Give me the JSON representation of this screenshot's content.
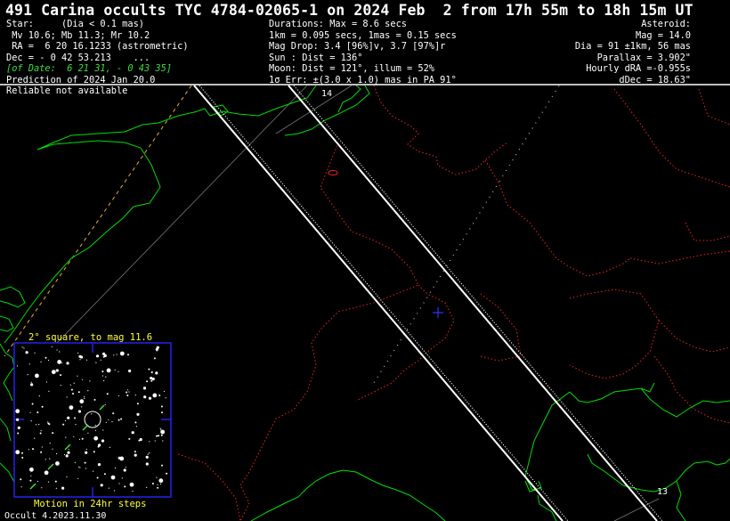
{
  "title": "491 Carina occults TYC 4784-02065-1 on 2024 Feb  2 from 17h 55m to 18h 15m UT",
  "star": {
    "heading": "Star:     (Dia < 0.1 mas)",
    "mags": " Mv 10.6; Mb 11.3; Mr 10.2",
    "ra": " RA =  6 20 16.1233 (astrometric)",
    "dec": "Dec = - 0 42 53.213    ...",
    "of_date": "[of Date:  6 21 31, - 0 43 35]",
    "prediction": "Prediction of 2024 Jan 20.0",
    "reliability": "Reliable not available"
  },
  "durations": {
    "max": "Durations: Max = 8.6 secs",
    "km": "1km = 0.095 secs, 1mas = 0.15 secs",
    "mag_drop": "Mag Drop: 3.4 [96%]v, 3.7 [97%]r",
    "sun": "Sun : Dist = 136°",
    "moon": "Moon: Dist = 121°, illum = 52%",
    "error": "1σ Err: ±(3.0 x 1.0) mas in PA 91°"
  },
  "asteroid": {
    "heading": "Asteroid:",
    "mag": "Mag = 14.0",
    "dia": "Dia = 91 ±1km, 56 mas",
    "parallax": "Parallax = 3.902\"",
    "hourly_dra": "Hourly dRA =-0.955s",
    "ddec": "dDec = 18.63\""
  },
  "path_labels": {
    "upper": "14",
    "lower": "13"
  },
  "inset": {
    "title": "2° square, to mag 11.6",
    "caption": "Motion in 24hr steps"
  },
  "footer": "Occult 4.2023.11.30",
  "colors": {
    "background": "#000000",
    "coastline": "#00dd00",
    "borders": "#ee2222",
    "path": "#ffffff",
    "inset_frame": "#2222ee",
    "inset_text": "#ffff33",
    "center_marker": "#3333ff"
  }
}
